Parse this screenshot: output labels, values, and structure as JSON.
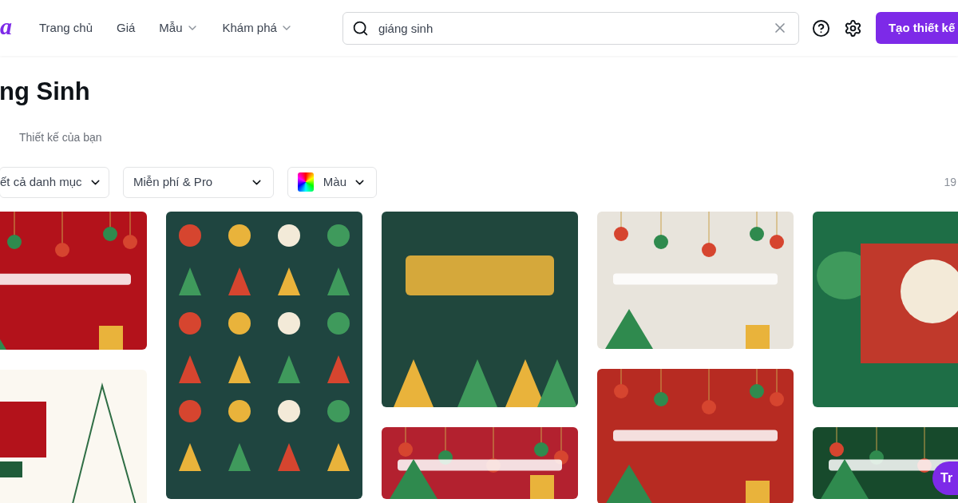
{
  "header": {
    "logo": "a",
    "nav": [
      {
        "label": "Trang chủ",
        "dropdown": false
      },
      {
        "label": "Giá",
        "dropdown": false
      },
      {
        "label": "Mẫu",
        "dropdown": true
      },
      {
        "label": "Khám phá",
        "dropdown": true
      }
    ],
    "search": {
      "value": "giáng sinh"
    },
    "create_button": "Tạo thiết kế"
  },
  "page_title": "ng Sinh",
  "your_designs_tab": "Thiết kế của bạn",
  "filters": [
    {
      "label": "ết cả danh mục",
      "kind": "dropdown"
    },
    {
      "label": "Miễn phí & Pro",
      "kind": "dropdown"
    },
    {
      "label": "Màu",
      "kind": "color"
    }
  ],
  "result_count": "19",
  "chat_button": "Tr"
}
